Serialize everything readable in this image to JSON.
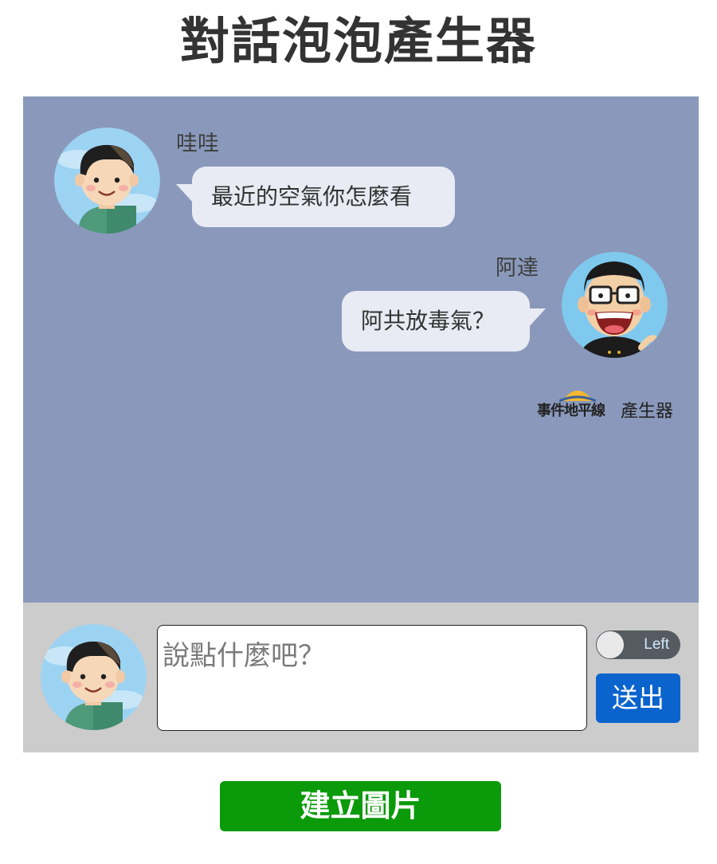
{
  "title": "對話泡泡產生器",
  "chat": {
    "background_color": "#8a99bb",
    "messages": [
      {
        "side": "left",
        "speaker": "哇哇",
        "text": "最近的空氣你怎麼看",
        "avatar_icon": "boy-avatar-icon"
      },
      {
        "side": "right",
        "speaker": "阿達",
        "text": "阿共放毒氣？",
        "avatar_icon": "glasses-man-avatar-icon"
      }
    ],
    "watermark": {
      "brand": "事件地平線",
      "suffix": "產生器"
    }
  },
  "composer": {
    "avatar_icon": "boy-avatar-icon",
    "placeholder": "說點什麼吧？",
    "value": "",
    "toggle_label": "Left",
    "toggle_on": false,
    "send_label": "送出",
    "send_color": "#0b63ce"
  },
  "build_button": {
    "label": "建立圖片",
    "color": "#0a9a0a"
  }
}
